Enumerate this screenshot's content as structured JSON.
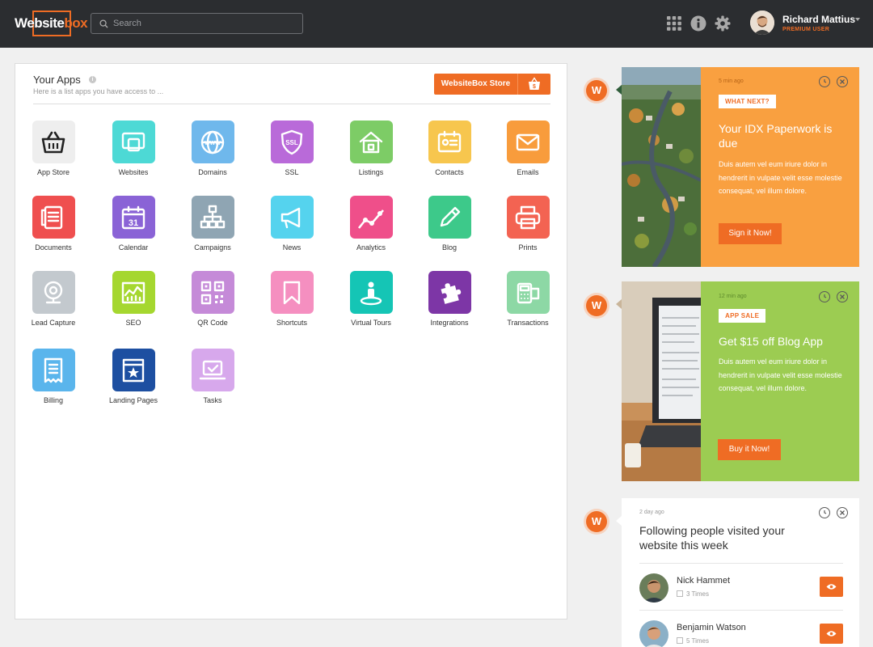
{
  "header": {
    "logo_main": "Website",
    "logo_accent": "box",
    "search_placeholder": "Search",
    "user_name": "Richard Mattius",
    "user_role": "PREMIUM USER"
  },
  "apps_panel": {
    "title": "Your Apps",
    "info": "i",
    "subtitle": "Here is a list apps you have access to ...",
    "store_button": "WebsiteBox Store",
    "store_bag_symbol": "$",
    "apps": [
      {
        "label": "App Store",
        "color": "#eeeeee",
        "icon": "basket-icon"
      },
      {
        "label": "Websites",
        "color": "#4dd9d5",
        "icon": "websites-icon"
      },
      {
        "label": "Domains",
        "color": "#6fb8ec",
        "icon": "globe-icon"
      },
      {
        "label": "SSL",
        "color": "#b96ad9",
        "icon": "ssl-shield-icon"
      },
      {
        "label": "Listings",
        "color": "#7dcc66",
        "icon": "house-icon"
      },
      {
        "label": "Contacts",
        "color": "#f7c64e",
        "icon": "contact-card-icon"
      },
      {
        "label": "Emails",
        "color": "#f89c3c",
        "icon": "envelope-icon"
      },
      {
        "label": "Documents",
        "color": "#ef4f4f",
        "icon": "documents-icon"
      },
      {
        "label": "Calendar",
        "color": "#8a63d6",
        "icon": "calendar-icon"
      },
      {
        "label": "Campaigns",
        "color": "#8fa5b3",
        "icon": "sitemap-icon"
      },
      {
        "label": "News",
        "color": "#55d3ee",
        "icon": "megaphone-icon"
      },
      {
        "label": "Analytics",
        "color": "#ef4f8a",
        "icon": "analytics-line-icon"
      },
      {
        "label": "Blog",
        "color": "#3dc98a",
        "icon": "pencil-icon"
      },
      {
        "label": "Prints",
        "color": "#f36352",
        "icon": "printer-icon"
      },
      {
        "label": "Lead Capture",
        "color": "#c3c9ce",
        "icon": "webcam-icon"
      },
      {
        "label": "SEO",
        "color": "#a5d72f",
        "icon": "seo-chart-icon"
      },
      {
        "label": "QR Code",
        "color": "#c58ad8",
        "icon": "qr-code-icon"
      },
      {
        "label": "Shortcuts",
        "color": "#f58fc0",
        "icon": "bookmark-icon"
      },
      {
        "label": "Virtual Tours",
        "color": "#15c5b5",
        "icon": "person-pin-icon"
      },
      {
        "label": "Integrations",
        "color": "#7d36a6",
        "icon": "puzzle-icon"
      },
      {
        "label": "Transactions",
        "color": "#8dd8a5",
        "icon": "cash-register-icon"
      },
      {
        "label": "Billing",
        "color": "#5ab5ec",
        "icon": "receipt-icon"
      },
      {
        "label": "Landing Pages",
        "color": "#1d4fa1",
        "icon": "star-page-icon"
      },
      {
        "label": "Tasks",
        "color": "#d7a8ec",
        "icon": "laptop-check-icon"
      }
    ]
  },
  "notifications": [
    {
      "badge": "W",
      "time": "5 min ago",
      "tag": "WHAT NEXT?",
      "title": "Your IDX Paperwork is due",
      "text": "Duis autem vel eum iriure dolor in hendrerit in vulpate velit esse molestie consequat, vel illum dolore.",
      "button": "Sign it Now!",
      "color": "#f9a040"
    },
    {
      "badge": "W",
      "time": "12 min ago",
      "tag": "APP SALE",
      "title": "Get $15 off Blog App",
      "text": "Duis autem vel eum iriure dolor in hendrerit in vulpate velit esse molestie consequat, vel illum dolore.",
      "button": "Buy it Now!",
      "color": "#9ccc52"
    }
  ],
  "visitors_card": {
    "badge": "W",
    "time": "2 day ago",
    "title": "Following people visited your website this week",
    "visitors": [
      {
        "name": "Nick Hammet",
        "times": "3 Times"
      },
      {
        "name": "Benjamin Watson",
        "times": "5 Times"
      }
    ]
  },
  "colors": {
    "accent": "#ef6c24",
    "topbar": "#2b2d30"
  }
}
